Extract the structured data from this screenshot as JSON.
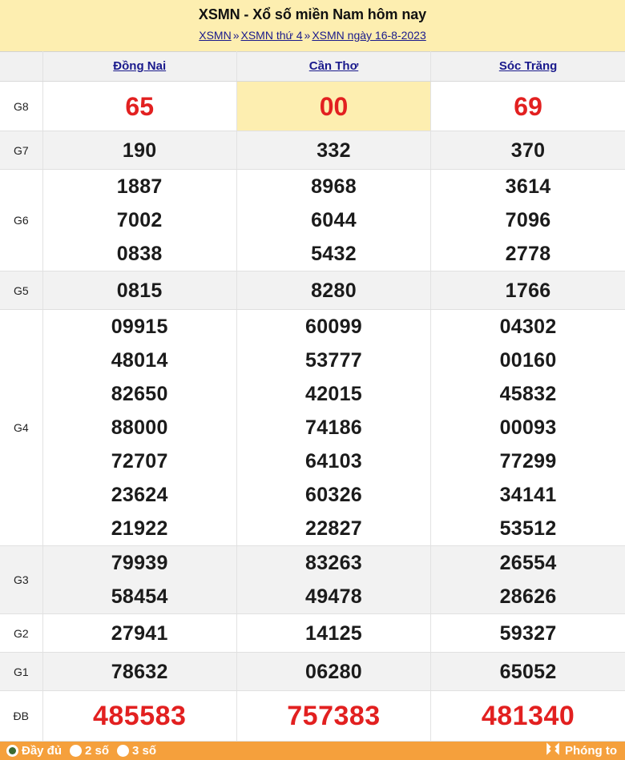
{
  "header": {
    "title": "XSMN - Xổ số miền Nam hôm nay",
    "breadcrumb": {
      "item1": "XSMN",
      "sep1": "»",
      "item2": "XSMN thứ 4",
      "sep2": "»",
      "item3": "XSMN ngày 16-8-2023"
    }
  },
  "table": {
    "corner_label": "",
    "columns": [
      "Đồng Nai",
      "Cần Thơ",
      "Sóc Trăng"
    ],
    "rows": [
      {
        "label": "G8",
        "style": "red",
        "highlight_col": 1,
        "values": [
          [
            "65"
          ],
          [
            "00"
          ],
          [
            "69"
          ]
        ]
      },
      {
        "label": "G7",
        "style": "normal",
        "values": [
          [
            "190"
          ],
          [
            "332"
          ],
          [
            "370"
          ]
        ]
      },
      {
        "label": "G6",
        "style": "normal",
        "values": [
          [
            "1887",
            "7002",
            "0838"
          ],
          [
            "8968",
            "6044",
            "5432"
          ],
          [
            "3614",
            "7096",
            "2778"
          ]
        ]
      },
      {
        "label": "G5",
        "style": "normal",
        "values": [
          [
            "0815"
          ],
          [
            "8280"
          ],
          [
            "1766"
          ]
        ]
      },
      {
        "label": "G4",
        "style": "normal",
        "values": [
          [
            "09915",
            "48014",
            "82650",
            "88000",
            "72707",
            "23624",
            "21922"
          ],
          [
            "60099",
            "53777",
            "42015",
            "74186",
            "64103",
            "60326",
            "22827"
          ],
          [
            "04302",
            "00160",
            "45832",
            "00093",
            "77299",
            "34141",
            "53512"
          ]
        ]
      },
      {
        "label": "G3",
        "style": "normal",
        "values": [
          [
            "79939",
            "58454"
          ],
          [
            "83263",
            "49478"
          ],
          [
            "26554",
            "28626"
          ]
        ]
      },
      {
        "label": "G2",
        "style": "normal",
        "values": [
          [
            "27941"
          ],
          [
            "14125"
          ],
          [
            "59327"
          ]
        ]
      },
      {
        "label": "G1",
        "style": "normal",
        "values": [
          [
            "78632"
          ],
          [
            "06280"
          ],
          [
            "65052"
          ]
        ]
      },
      {
        "label": "ĐB",
        "style": "db",
        "values": [
          [
            "485583"
          ],
          [
            "757383"
          ],
          [
            "481340"
          ]
        ]
      }
    ]
  },
  "footer": {
    "options": [
      {
        "label": "Đầy đủ",
        "selected": true
      },
      {
        "label": "2 số",
        "selected": false
      },
      {
        "label": "3 số",
        "selected": false
      }
    ],
    "zoom_label": "Phóng to",
    "zoom_icon": "expand-icon"
  },
  "colors": {
    "header_bg": "#fdeeb0",
    "link": "#1a1a8c",
    "red": "#e22020",
    "stripe": "#f2f2f2",
    "footer_bg": "#f5a03c",
    "radio_on": "#3d6b30"
  }
}
